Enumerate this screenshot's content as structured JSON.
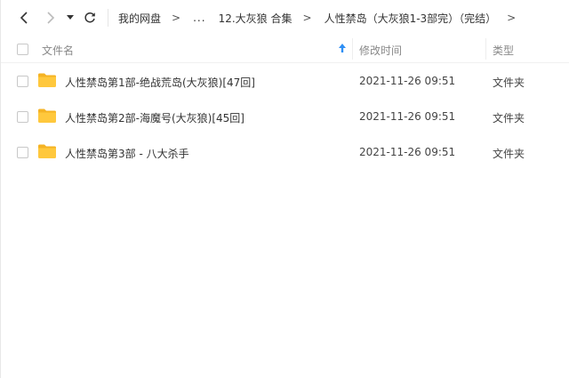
{
  "nav": {
    "breadcrumb": [
      "我的网盘",
      "...",
      "12.大灰狼 合集",
      "人性禁岛（大灰狼1-3部完）（完结）"
    ],
    "separator": ">"
  },
  "columns": {
    "name": "文件名",
    "date": "修改时间",
    "type": "类型"
  },
  "rows": [
    {
      "name": "人性禁岛第1部-绝战荒岛(大灰狼)[47回]",
      "date": "2021-11-26 09:51",
      "type": "文件夹"
    },
    {
      "name": "人性禁岛第2部-海魔号(大灰狼)[45回]",
      "date": "2021-11-26 09:51",
      "type": "文件夹"
    },
    {
      "name": "人性禁岛第3部 - 八大杀手",
      "date": "2021-11-26 09:51",
      "type": "文件夹"
    }
  ],
  "colors": {
    "folder": "#ffc83d",
    "folder_tab": "#f5b324",
    "sort_arrow": "#2e8ff5"
  },
  "icons": {
    "back": "chevron-left-icon",
    "forward": "chevron-right-icon",
    "history": "caret-down-icon",
    "refresh": "refresh-icon",
    "folder": "folder-icon",
    "sort": "sort-up-arrow-icon"
  }
}
